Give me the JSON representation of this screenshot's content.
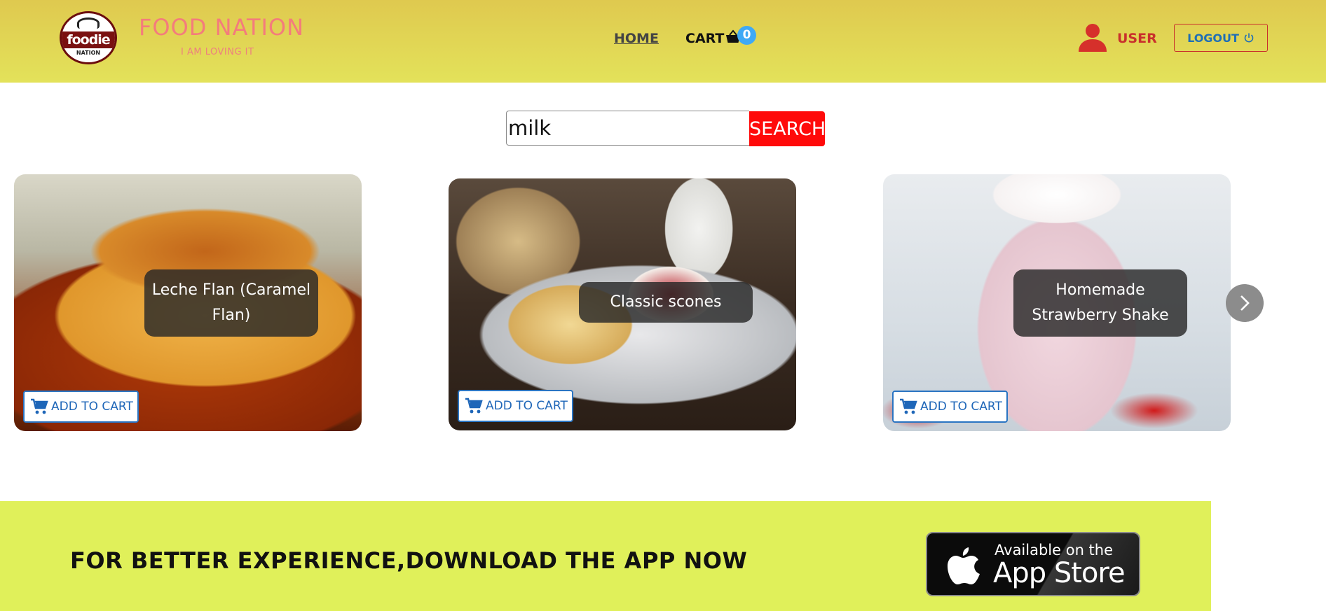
{
  "header": {
    "logo_word": "foodie",
    "logo_sub": "NATION",
    "brand_title": "FOOD NATION",
    "brand_tagline": "I AM LOVING IT",
    "nav_home": "HOME",
    "nav_cart": "CART",
    "cart_count": "0",
    "user_label": "USER",
    "logout_label": "LOGOUT"
  },
  "search": {
    "value": "milk",
    "button_label": "SEARCH"
  },
  "cards": [
    {
      "title": "Leche Flan (Caramel Flan)",
      "add_label": "ADD TO CART"
    },
    {
      "title": "Classic scones",
      "add_label": "ADD TO CART"
    },
    {
      "title": "Homemade Strawberry Shake",
      "add_label": "ADD TO CART"
    }
  ],
  "banner": {
    "text": "FOR BETTER EXPERIENCE,DOWNLOAD THE APP NOW",
    "appstore_small": "Available on the",
    "appstore_big": "App Store"
  },
  "colors": {
    "header_bg": "#e3e25a",
    "brand": "#f47c7c",
    "search_button": "#ff0a0a",
    "banner_bg": "#e0f05a",
    "cart_badge": "#3fa9f5"
  }
}
